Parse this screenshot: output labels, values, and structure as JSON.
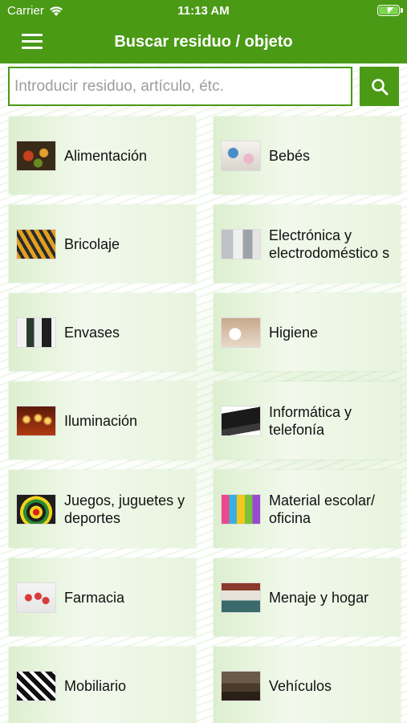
{
  "status_bar": {
    "carrier": "Carrier",
    "time": "11:13 AM"
  },
  "header": {
    "title": "Buscar residuo / objeto",
    "menu_icon": "hamburger-menu-icon"
  },
  "search": {
    "placeholder": "Introducir residuo, artículo, étc.",
    "value": "",
    "button_icon": "search-icon"
  },
  "colors": {
    "brand_green": "#4a9a16",
    "tile_bg": "#e8f4de"
  },
  "categories": [
    {
      "label": "Alimentación",
      "thumb": "food-photo"
    },
    {
      "label": "Bebés",
      "thumb": "baby-items-photo"
    },
    {
      "label": "Bricolaje",
      "thumb": "tools-photo"
    },
    {
      "label": "Electrónica y electrodoméstico s",
      "thumb": "appliances-photo"
    },
    {
      "label": "Envases",
      "thumb": "containers-photo"
    },
    {
      "label": "Higiene",
      "thumb": "hygiene-photo"
    },
    {
      "label": "Iluminación",
      "thumb": "candles-photo"
    },
    {
      "label": "Informática y telefonía",
      "thumb": "laptop-photo"
    },
    {
      "label": "Juegos, juguetes y deportes",
      "thumb": "darts-photo"
    },
    {
      "label": "Material escolar/ oficina",
      "thumb": "school-supplies-photo"
    },
    {
      "label": "Farmacia",
      "thumb": "pills-photo"
    },
    {
      "label": "Menaje y hogar",
      "thumb": "kitchen-photo"
    },
    {
      "label": "Mobiliario",
      "thumb": "furniture-photo"
    },
    {
      "label": "Vehículos",
      "thumb": "vehicles-photo"
    }
  ]
}
